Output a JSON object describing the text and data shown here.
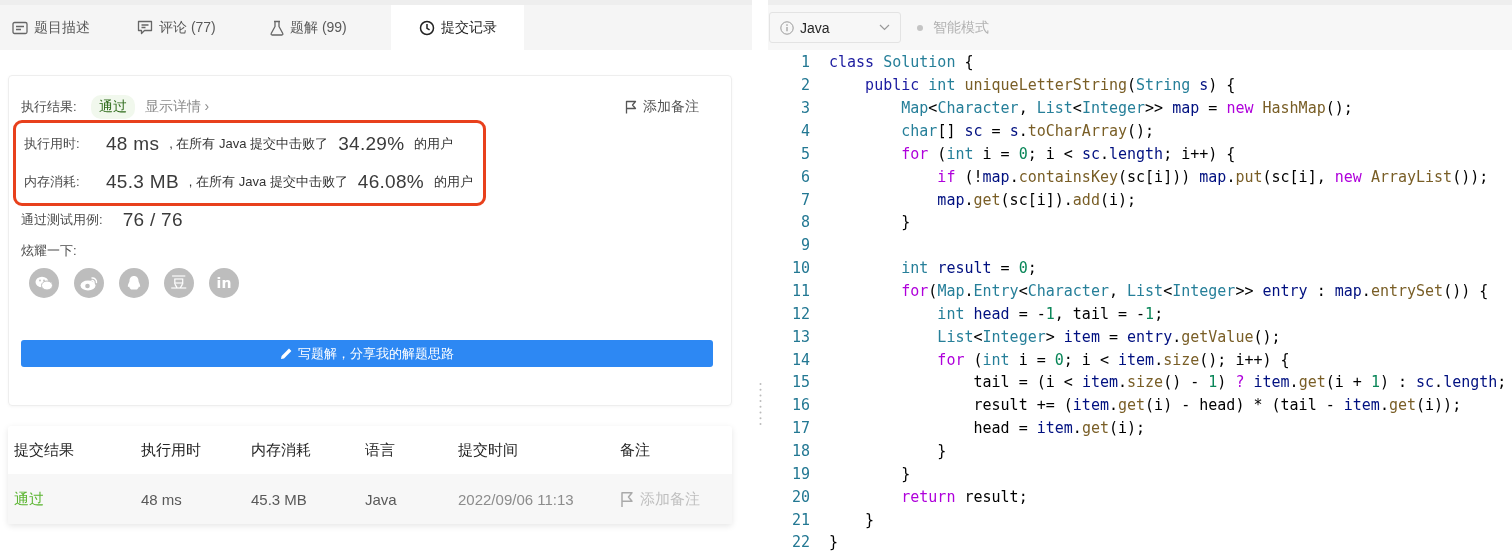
{
  "tabs": [
    {
      "kind": "description",
      "label": "题目描述",
      "selected": false
    },
    {
      "kind": "comments",
      "label": "评论 (77)",
      "selected": false
    },
    {
      "kind": "solutions",
      "label": "题解 (99)",
      "selected": false
    },
    {
      "kind": "submissions",
      "label": "提交记录",
      "selected": true
    }
  ],
  "result": {
    "label": "执行结果:",
    "status": "通过",
    "details_link": "显示详情 ›",
    "add_note": "添加备注",
    "stats_highlighted": true,
    "stats": [
      {
        "label": "执行用时:",
        "value": "48 ms",
        "text": ", 在所有 Java 提交中击败了",
        "percent": "34.29%",
        "suffix": "的用户"
      },
      {
        "label": "内存消耗:",
        "value": "45.3 MB",
        "text": ", 在所有 Java 提交中击败了",
        "percent": "46.08%",
        "suffix": "的用户"
      }
    ],
    "tests_label": "通过测试用例:",
    "tests_value": "76 / 76",
    "share_label": "炫耀一下:",
    "share_buttons": [
      {
        "kind": "wechat"
      },
      {
        "kind": "weibo"
      },
      {
        "kind": "qq"
      },
      {
        "kind": "douban",
        "glyph": "豆"
      },
      {
        "kind": "linkedin",
        "glyph": "in"
      }
    ],
    "write_button": "写题解，分享我的解题思路"
  },
  "table": {
    "columns": [
      "提交结果",
      "执行用时",
      "内存消耗",
      "语言",
      "提交时间",
      "备注"
    ],
    "rows": [
      {
        "status": "通过",
        "time": "48 ms",
        "memory": "45.3 MB",
        "language": "Java",
        "submitted": "2022/09/06 11:13",
        "note": "添加备注"
      }
    ]
  },
  "editor": {
    "language": "Java",
    "mode": {
      "label": "智能模式",
      "on": false
    },
    "lines": [
      {
        "number": "1",
        "tokens": [
          {
            "text": "class ",
            "kind": "kw"
          },
          {
            "text": "Solution",
            "kind": "type"
          },
          {
            "text": " {",
            "kind": "plain"
          }
        ]
      },
      {
        "number": "2",
        "tokens": [
          {
            "text": "    public ",
            "kind": "kw"
          },
          {
            "text": "int ",
            "kind": "type"
          },
          {
            "text": "uniqueLetterString",
            "kind": "fn"
          },
          {
            "text": "(",
            "kind": "plain"
          },
          {
            "text": "String ",
            "kind": "type"
          },
          {
            "text": "s",
            "kind": "var"
          },
          {
            "text": ") {",
            "kind": "plain"
          }
        ]
      },
      {
        "number": "3",
        "tokens": [
          {
            "text": "        Map",
            "kind": "type"
          },
          {
            "text": "<",
            "kind": "plain"
          },
          {
            "text": "Character",
            "kind": "type"
          },
          {
            "text": ", ",
            "kind": "plain"
          },
          {
            "text": "List",
            "kind": "type"
          },
          {
            "text": "<",
            "kind": "plain"
          },
          {
            "text": "Integer",
            "kind": "type"
          },
          {
            "text": ">> ",
            "kind": "plain"
          },
          {
            "text": "map",
            "kind": "var"
          },
          {
            "text": " = ",
            "kind": "plain"
          },
          {
            "text": "new ",
            "kind": "ctrl"
          },
          {
            "text": "HashMap",
            "kind": "fn"
          },
          {
            "text": "();",
            "kind": "plain"
          }
        ]
      },
      {
        "number": "4",
        "tokens": [
          {
            "text": "        char",
            "kind": "type"
          },
          {
            "text": "[] ",
            "kind": "plain"
          },
          {
            "text": "sc",
            "kind": "var"
          },
          {
            "text": " = ",
            "kind": "plain"
          },
          {
            "text": "s",
            "kind": "var"
          },
          {
            "text": ".",
            "kind": "plain"
          },
          {
            "text": "toCharArray",
            "kind": "fn"
          },
          {
            "text": "();",
            "kind": "plain"
          }
        ]
      },
      {
        "number": "5",
        "tokens": [
          {
            "text": "        for",
            "kind": "ctrl"
          },
          {
            "text": " (",
            "kind": "plain"
          },
          {
            "text": "int",
            "kind": "type"
          },
          {
            "text": " i = ",
            "kind": "plain"
          },
          {
            "text": "0",
            "kind": "num"
          },
          {
            "text": "; i < ",
            "kind": "plain"
          },
          {
            "text": "sc",
            "kind": "var"
          },
          {
            "text": ".",
            "kind": "plain"
          },
          {
            "text": "length",
            "kind": "var"
          },
          {
            "text": "; i++) {",
            "kind": "plain"
          }
        ]
      },
      {
        "number": "6",
        "tokens": [
          {
            "text": "            if",
            "kind": "ctrl"
          },
          {
            "text": " (!",
            "kind": "plain"
          },
          {
            "text": "map",
            "kind": "var"
          },
          {
            "text": ".",
            "kind": "plain"
          },
          {
            "text": "containsKey",
            "kind": "fn"
          },
          {
            "text": "(sc[i])) ",
            "kind": "plain"
          },
          {
            "text": "map",
            "kind": "var"
          },
          {
            "text": ".",
            "kind": "plain"
          },
          {
            "text": "put",
            "kind": "fn"
          },
          {
            "text": "(sc[i], ",
            "kind": "plain"
          },
          {
            "text": "new ",
            "kind": "ctrl"
          },
          {
            "text": "ArrayList",
            "kind": "fn"
          },
          {
            "text": "());",
            "kind": "plain"
          }
        ]
      },
      {
        "number": "7",
        "tokens": [
          {
            "text": "            map",
            "kind": "var"
          },
          {
            "text": ".",
            "kind": "plain"
          },
          {
            "text": "get",
            "kind": "fn"
          },
          {
            "text": "(sc[i]).",
            "kind": "plain"
          },
          {
            "text": "add",
            "kind": "fn"
          },
          {
            "text": "(i);",
            "kind": "plain"
          }
        ]
      },
      {
        "number": "8",
        "tokens": [
          {
            "text": "        }",
            "kind": "plain"
          }
        ]
      },
      {
        "number": "9"
      },
      {
        "number": "10",
        "tokens": [
          {
            "text": "        int ",
            "kind": "type"
          },
          {
            "text": "result",
            "kind": "var"
          },
          {
            "text": " = ",
            "kind": "plain"
          },
          {
            "text": "0",
            "kind": "num"
          },
          {
            "text": ";",
            "kind": "plain"
          }
        ]
      },
      {
        "number": "11",
        "tokens": [
          {
            "text": "        for",
            "kind": "ctrl"
          },
          {
            "text": "(",
            "kind": "plain"
          },
          {
            "text": "Map",
            "kind": "type"
          },
          {
            "text": ".",
            "kind": "plain"
          },
          {
            "text": "Entry",
            "kind": "type"
          },
          {
            "text": "<",
            "kind": "plain"
          },
          {
            "text": "Character",
            "kind": "type"
          },
          {
            "text": ", ",
            "kind": "plain"
          },
          {
            "text": "List",
            "kind": "type"
          },
          {
            "text": "<",
            "kind": "plain"
          },
          {
            "text": "Integer",
            "kind": "type"
          },
          {
            "text": ">> ",
            "kind": "plain"
          },
          {
            "text": "entry",
            "kind": "var"
          },
          {
            "text": " : ",
            "kind": "plain"
          },
          {
            "text": "map",
            "kind": "var"
          },
          {
            "text": ".",
            "kind": "plain"
          },
          {
            "text": "entrySet",
            "kind": "fn"
          },
          {
            "text": "()) {",
            "kind": "plain"
          }
        ]
      },
      {
        "number": "12",
        "tokens": [
          {
            "text": "            int ",
            "kind": "type"
          },
          {
            "text": "head",
            "kind": "var"
          },
          {
            "text": " = -",
            "kind": "plain"
          },
          {
            "text": "1",
            "kind": "num"
          },
          {
            "text": ", tail = -",
            "kind": "plain"
          },
          {
            "text": "1",
            "kind": "num"
          },
          {
            "text": ";",
            "kind": "plain"
          }
        ]
      },
      {
        "number": "13",
        "tokens": [
          {
            "text": "            List",
            "kind": "type"
          },
          {
            "text": "<",
            "kind": "plain"
          },
          {
            "text": "Integer",
            "kind": "type"
          },
          {
            "text": "> ",
            "kind": "plain"
          },
          {
            "text": "item",
            "kind": "var"
          },
          {
            "text": " = ",
            "kind": "plain"
          },
          {
            "text": "entry",
            "kind": "var"
          },
          {
            "text": ".",
            "kind": "plain"
          },
          {
            "text": "getValue",
            "kind": "fn"
          },
          {
            "text": "();",
            "kind": "plain"
          }
        ]
      },
      {
        "number": "14",
        "tokens": [
          {
            "text": "            for",
            "kind": "ctrl"
          },
          {
            "text": " (",
            "kind": "plain"
          },
          {
            "text": "int",
            "kind": "type"
          },
          {
            "text": " i = ",
            "kind": "plain"
          },
          {
            "text": "0",
            "kind": "num"
          },
          {
            "text": "; i < ",
            "kind": "plain"
          },
          {
            "text": "item",
            "kind": "var"
          },
          {
            "text": ".",
            "kind": "plain"
          },
          {
            "text": "size",
            "kind": "fn"
          },
          {
            "text": "(); i++) {",
            "kind": "plain"
          }
        ]
      },
      {
        "number": "15",
        "tokens": [
          {
            "text": "                tail = (i < ",
            "kind": "plain"
          },
          {
            "text": "item",
            "kind": "var"
          },
          {
            "text": ".",
            "kind": "plain"
          },
          {
            "text": "size",
            "kind": "fn"
          },
          {
            "text": "() - ",
            "kind": "plain"
          },
          {
            "text": "1",
            "kind": "num"
          },
          {
            "text": ") ",
            "kind": "plain"
          },
          {
            "text": "? ",
            "kind": "ctrl"
          },
          {
            "text": "item",
            "kind": "var"
          },
          {
            "text": ".",
            "kind": "plain"
          },
          {
            "text": "get",
            "kind": "fn"
          },
          {
            "text": "(i + ",
            "kind": "plain"
          },
          {
            "text": "1",
            "kind": "num"
          },
          {
            "text": ") : ",
            "kind": "plain"
          },
          {
            "text": "sc",
            "kind": "var"
          },
          {
            "text": ".",
            "kind": "plain"
          },
          {
            "text": "length",
            "kind": "var"
          },
          {
            "text": ";",
            "kind": "plain"
          }
        ]
      },
      {
        "number": "16",
        "tokens": [
          {
            "text": "                result += (",
            "kind": "plain"
          },
          {
            "text": "item",
            "kind": "var"
          },
          {
            "text": ".",
            "kind": "plain"
          },
          {
            "text": "get",
            "kind": "fn"
          },
          {
            "text": "(i) - head) * (tail - ",
            "kind": "plain"
          },
          {
            "text": "item",
            "kind": "var"
          },
          {
            "text": ".",
            "kind": "plain"
          },
          {
            "text": "get",
            "kind": "fn"
          },
          {
            "text": "(i));",
            "kind": "plain"
          }
        ]
      },
      {
        "number": "17",
        "tokens": [
          {
            "text": "                head = ",
            "kind": "plain"
          },
          {
            "text": "item",
            "kind": "var"
          },
          {
            "text": ".",
            "kind": "plain"
          },
          {
            "text": "get",
            "kind": "fn"
          },
          {
            "text": "(i);",
            "kind": "plain"
          }
        ]
      },
      {
        "number": "18",
        "tokens": [
          {
            "text": "            }",
            "kind": "plain"
          }
        ]
      },
      {
        "number": "19",
        "tokens": [
          {
            "text": "        }",
            "kind": "plain"
          }
        ]
      },
      {
        "number": "20",
        "tokens": [
          {
            "text": "        return",
            "kind": "ctrl"
          },
          {
            "text": " result;",
            "kind": "plain"
          }
        ]
      },
      {
        "number": "21",
        "tokens": [
          {
            "text": "    }",
            "kind": "plain"
          }
        ]
      },
      {
        "number": "22",
        "tokens": [
          {
            "text": "}",
            "kind": "plain"
          }
        ]
      }
    ]
  }
}
